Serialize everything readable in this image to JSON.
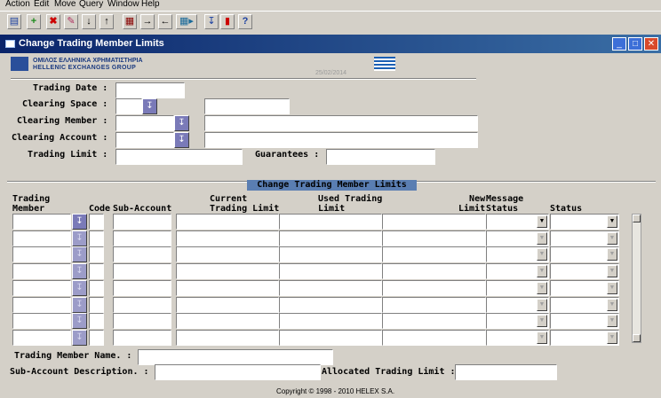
{
  "menu": [
    "Action",
    "Edit",
    "Move",
    "Query",
    "Window",
    "Help"
  ],
  "toolbar_icons": [
    "save-icon",
    "insert-record-icon",
    "delete-record-icon",
    "clear-icon",
    "next-record-icon",
    "previous-record-icon",
    "enter-query-icon",
    "next-block-icon",
    "previous-block-icon",
    "execute-query-icon",
    "list-of-values-icon",
    "exit-icon",
    "help-icon"
  ],
  "window": {
    "title": "Change Trading Member Limits"
  },
  "header": {
    "logo_line1": "ΟΜΙΛΟΣ ΕΛΛΗΝΙΚΑ ΧΡΗΜΑΤΙΣΤΗΡΙΑ",
    "logo_line2": "HELLENIC EXCHANGES GROUP",
    "date": "25/02/2014"
  },
  "form": {
    "trading_date_label": "Trading Date :",
    "clearing_space_label": "Clearing Space :",
    "clearing_member_label": "Clearing Member :",
    "clearing_account_label": "Clearing Account :",
    "trading_limit_label": "Trading Limit :",
    "guarantees_label": "Guarantees :"
  },
  "grid": {
    "section_title": "Change Trading Member Limits",
    "headers": {
      "trading_member": "Trading\nMember",
      "code": "Code",
      "sub_account": "Sub-Account",
      "current_limit": "Current\nTrading Limit",
      "used_limit": "Used Trading\nLimit",
      "new_limit": "New\nLimit",
      "message_status": "Message\nStatus",
      "status": "Status"
    },
    "row_count": 8
  },
  "footer": {
    "member_name_label": "Trading Member Name. :",
    "subaccount_desc_label": "Sub-Account Description. :",
    "allocated_limit_label": "Allocated Trading Limit :",
    "copyright": "Copyright © 1998 - 2010 HELEX S.A."
  }
}
